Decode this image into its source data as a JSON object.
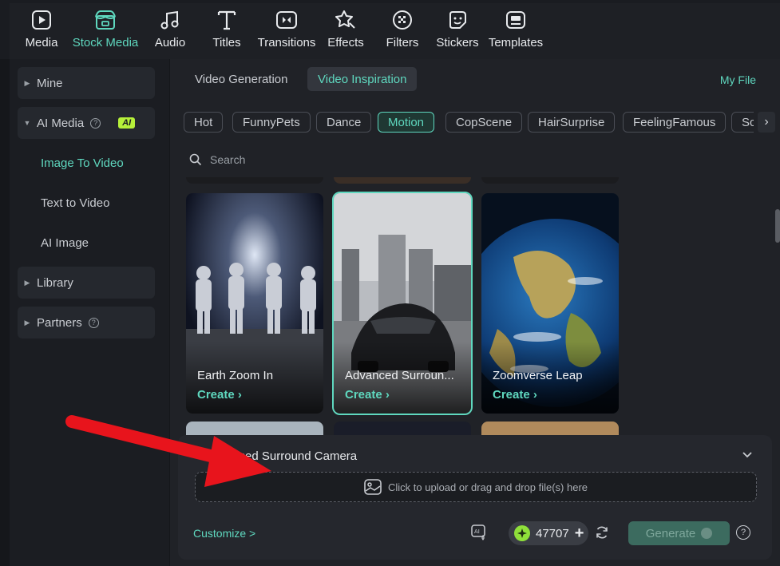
{
  "toolbar": {
    "items": [
      {
        "label": "Media",
        "icon": "media-icon"
      },
      {
        "label": "Stock Media",
        "icon": "stock-media-icon",
        "active": true
      },
      {
        "label": "Audio",
        "icon": "music-note-icon"
      },
      {
        "label": "Titles",
        "icon": "text-t-icon"
      },
      {
        "label": "Transitions",
        "icon": "transitions-icon"
      },
      {
        "label": "Effects",
        "icon": "effects-icon"
      },
      {
        "label": "Filters",
        "icon": "filters-icon"
      },
      {
        "label": "Stickers",
        "icon": "stickers-icon"
      },
      {
        "label": "Templates",
        "icon": "templates-icon"
      }
    ]
  },
  "sidebar": {
    "mine": "Mine",
    "ai_media": "AI Media",
    "ai_badge": "AI",
    "image_to_video": "Image To Video",
    "text_to_video": "Text to Video",
    "ai_image": "AI Image",
    "library": "Library",
    "partners": "Partners"
  },
  "main": {
    "tabs": [
      {
        "label": "Video Generation",
        "active": false
      },
      {
        "label": "Video Inspiration",
        "active": true
      }
    ],
    "my_file": "My File",
    "chips": [
      "Hot",
      "FunnyPets",
      "Dance",
      "Motion",
      "CopScene",
      "HairSurprise",
      "FeelingFamous",
      "Sc"
    ],
    "active_chip": "Motion",
    "search_placeholder": "Search",
    "cards": [
      {
        "title": "Earth Zoom In",
        "action": "Create"
      },
      {
        "title": "Advanced Surroun...",
        "action": "Create"
      },
      {
        "title": "Zoomverse Leap",
        "action": "Create"
      }
    ]
  },
  "panel": {
    "title": "Advanced Surround Camera",
    "title_visible": "ced Surround Camera",
    "upload_text": "Click to upload or drag and drop file(s) here",
    "customize": "Customize >",
    "credits": "47707",
    "generate": "Generate"
  },
  "colors": {
    "accent": "#5fd8bf",
    "background": "#202227",
    "annotation_arrow": "#e8141c"
  }
}
